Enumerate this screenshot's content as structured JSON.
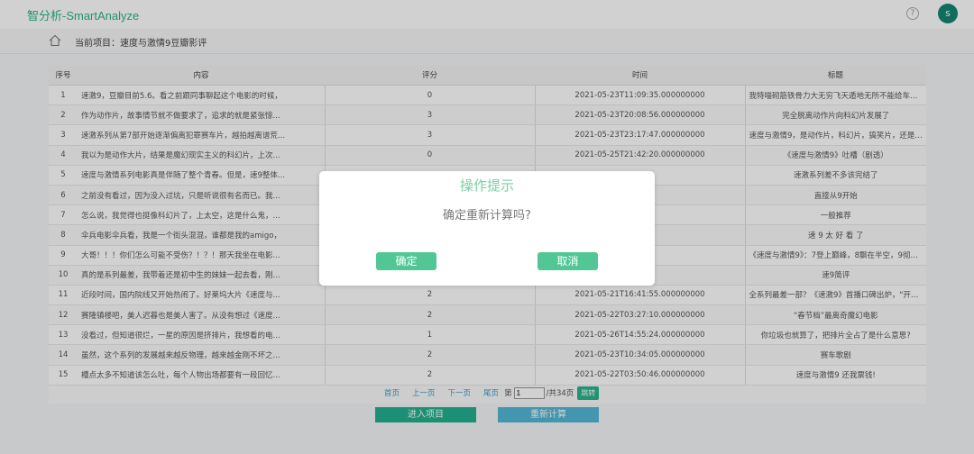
{
  "header": {
    "brand": "智分析-SmartAnalyze",
    "help_icon": "help-circle-icon",
    "avatar_initial": "s"
  },
  "breadcrumb": {
    "home_icon": "home-icon",
    "label": "当前项目：速度与激情9豆瓣影评"
  },
  "table": {
    "columns": [
      "序号",
      "内容",
      "评分",
      "时间",
      "标题"
    ],
    "rows": [
      [
        "1",
        "速激9，豆瓣目前5.6。看之前跟同事聊起这个电影的时候，",
        "0",
        "2021-05-23T11:09:35.000000000",
        "我特喵砌筋铁骨力大无穷飞天遁地无所不能给车屁股点把..."
      ],
      [
        "2",
        "作为动作片，故事情节就不做要求了，追求的就是紧张惊...",
        "3",
        "2021-05-23T20:08:56.000000000",
        "完全脱离动作片向科幻片发展了"
      ],
      [
        "3",
        "速激系列从第7部开始逐渐偏离犯罪赛车片，越拍越离谱荒...",
        "3",
        "2021-05-23T23:17:47.000000000",
        "速度与激情9，是动作片，科幻片，搞笑片，还是飙车片?"
      ],
      [
        "4",
        "我以为是动作大片，结果是魔幻现实主义的科幻片，上次...",
        "0",
        "2021-05-25T21:42:20.000000000",
        "《速度与激情9》吐槽（剧透）"
      ],
      [
        "5",
        "速度与激情系列电影真是伴随了整个青春。但是，速9整体...",
        "",
        "",
        "速激系列差不多该完结了"
      ],
      [
        "6",
        "之前没有看过，因为没入过坑，只是听说很有名而已。我...",
        "",
        "",
        "直接从9开始"
      ],
      [
        "7",
        "怎么说，我觉得也挺像科幻片了，上太空，这是什么鬼，...",
        "",
        "",
        "一般推荐"
      ],
      [
        "8",
        "伞兵电影伞兵看，我是一个街头混混，谁都是我的amigo，",
        "",
        "",
        "速 9 太 好 看 了"
      ],
      [
        "9",
        "大哥！！！你们怎么可能不受伤？！？！那天我坐在电影...",
        "",
        "",
        "《速度与激情9》：7登上巅峰，8飘在半空，9彻底陨落!..."
      ],
      [
        "10",
        "真的是系列最差，我带着还是初中生的妹妹一起去看，刚...",
        "",
        "",
        "速9简评"
      ],
      [
        "11",
        "近段时间，国内院线又开始热闹了。好莱坞大片《速度与...",
        "2",
        "2021-05-21T16:41:55.000000000",
        "全系列最差一部？《速激9》首播口碑出炉，\"开车撞卫星\"..."
      ],
      [
        "12",
        "赛隆镇楼吧，美人迟暮也是美人害了。从没有想过《速度...",
        "2",
        "2021-05-22T03:27:10.000000000",
        "“春节档”最离奇魔幻电影"
      ],
      [
        "13",
        "没看过，但知道很烂，一星的原因是挤排片，我想看的电...",
        "1",
        "2021-05-26T14:55:24.000000000",
        "你垃圾也就算了，把排片全占了是什么意思?"
      ],
      [
        "14",
        "虽然，这个系列的发展越来越反物理，越来越金刚不坏之...",
        "2",
        "2021-05-23T10:34:05.000000000",
        "赛车歌剧"
      ],
      [
        "15",
        "槽点太多不知道该怎么吐，每个人物出场都要有一段回忆...",
        "2",
        "2021-05-22T03:50:46.000000000",
        "速度与激情9 还我票钱!"
      ]
    ]
  },
  "pager": {
    "first": "首页",
    "prev": "上一页",
    "next": "下一页",
    "last": "尾页",
    "page_prefix": "第",
    "current_page": "1",
    "page_suffix": "/共34页",
    "goto": "跳转"
  },
  "actions": {
    "enter_project": "进入项目",
    "recalculate": "重新计算"
  },
  "modal": {
    "title": "操作提示",
    "message": "确定重新计算吗?",
    "ok": "确定",
    "cancel": "取消"
  }
}
